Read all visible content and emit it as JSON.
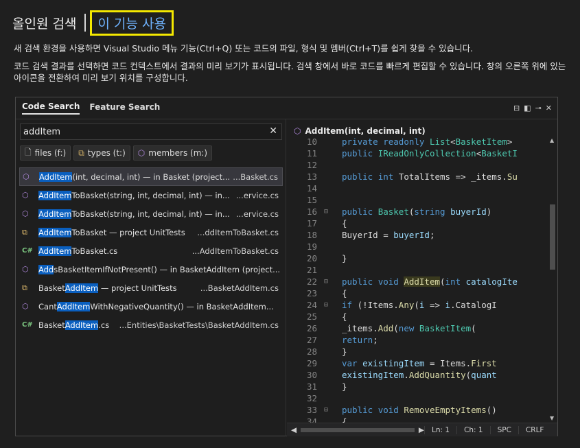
{
  "header": {
    "title": "올인원 검색",
    "link": "이 기능 사용"
  },
  "description": {
    "line1": "새 검색 환경을 사용하면 Visual Studio 메뉴 기능(Ctrl+Q) 또는 코드의 파일, 형식 및 멤버(Ctrl+T)를 쉽게 찾을 수 있습니다.",
    "line2": "코드 검색 결과를 선택하면 코드 컨텍스트에서 결과의 미리 보기가 표시됩니다. 검색 창에서 바로 코드를 빠르게 편집할 수 있습니다. 창의 오른쪽 위에 있는 아이콘을 전환하여 미리 보기 위치를 구성합니다."
  },
  "window": {
    "tabs": [
      "Code Search",
      "Feature Search"
    ],
    "search_value": "addItem",
    "filters": [
      {
        "icon": "file-icon",
        "label": "files (f:)"
      },
      {
        "icon": "types-icon",
        "label": "types (t:)"
      },
      {
        "icon": "member-icon",
        "label": "members (m:)"
      }
    ],
    "results": [
      {
        "icon": "method",
        "pre": "",
        "hl": "AddItem",
        "post": "(int, decimal, int) — in Basket (project...",
        "file": "...Basket.cs",
        "selected": true
      },
      {
        "icon": "method",
        "pre": "",
        "hl": "AddItem",
        "post": "ToBasket(string, int, decimal, int) — in...",
        "file": "...ervice.cs",
        "selected": false
      },
      {
        "icon": "method",
        "pre": "",
        "hl": "AddItem",
        "post": "ToBasket(string, int, decimal, int) — in...",
        "file": "...ervice.cs",
        "selected": false
      },
      {
        "icon": "project",
        "pre": "",
        "hl": "AddItem",
        "post": "ToBasket — project UnitTests",
        "file": "...ddItemToBasket.cs",
        "selected": false
      },
      {
        "icon": "csharp",
        "pre": "",
        "hl": "AddItem",
        "post": "ToBasket.cs",
        "file": "...AddItemToBasket.cs",
        "selected": false
      },
      {
        "icon": "method",
        "pre": "",
        "hl": "Add",
        "post": "sBasketItemIfNotPresent() — in BasketAddItem (project...",
        "file": "",
        "selected": false
      },
      {
        "icon": "project",
        "pre": "Basket",
        "hl": "AddItem",
        "post": " — project UnitTests",
        "file": "...BasketAddItem.cs",
        "selected": false
      },
      {
        "icon": "method",
        "pre": "Cant",
        "hl": "AddItem",
        "post": "WithNegativeQuantity() — in BasketAddItem...",
        "file": "",
        "selected": false
      },
      {
        "icon": "csharp",
        "pre": "Basket",
        "hl": "AddItem",
        "post": ".cs",
        "file": "...Entities\\BasketTests\\BasketAddItem.cs",
        "selected": false
      }
    ],
    "preview_title": "AddItem(int, decimal, int)",
    "code_lines": [
      {
        "n": "10",
        "t": "    private readonly List<BasketItem>"
      },
      {
        "n": "11",
        "t": "    public IReadOnlyCollection<BasketI"
      },
      {
        "n": "12",
        "t": ""
      },
      {
        "n": "13",
        "t": "    public int TotalItems => _items.Su"
      },
      {
        "n": "14",
        "t": ""
      },
      {
        "n": "15",
        "t": ""
      },
      {
        "n": "16",
        "t": "    public Basket(string buyerId)"
      },
      {
        "n": "17",
        "t": "    {"
      },
      {
        "n": "18",
        "t": "        BuyerId = buyerId;"
      },
      {
        "n": "19",
        "t": ""
      },
      {
        "n": "20",
        "t": "    }"
      },
      {
        "n": "21",
        "t": ""
      },
      {
        "n": "22",
        "t": "    public void AddItem(int catalogIte"
      },
      {
        "n": "23",
        "t": "    {"
      },
      {
        "n": "24",
        "t": "        if (!Items.Any(i => i.CatalogI"
      },
      {
        "n": "25",
        "t": "        {"
      },
      {
        "n": "26",
        "t": "            _items.Add(new BasketItem("
      },
      {
        "n": "27",
        "t": "            return;"
      },
      {
        "n": "28",
        "t": "        }"
      },
      {
        "n": "29",
        "t": "        var existingItem = Items.First"
      },
      {
        "n": "30",
        "t": "        existingItem.AddQuantity(quant"
      },
      {
        "n": "31",
        "t": "    }"
      },
      {
        "n": "32",
        "t": ""
      },
      {
        "n": "33",
        "t": "    public void RemoveEmptyItems()"
      },
      {
        "n": "34",
        "t": "    {"
      }
    ],
    "status": {
      "line": "Ln: 1",
      "col": "Ch: 1",
      "spc": "SPC",
      "eol": "CRLF"
    }
  }
}
